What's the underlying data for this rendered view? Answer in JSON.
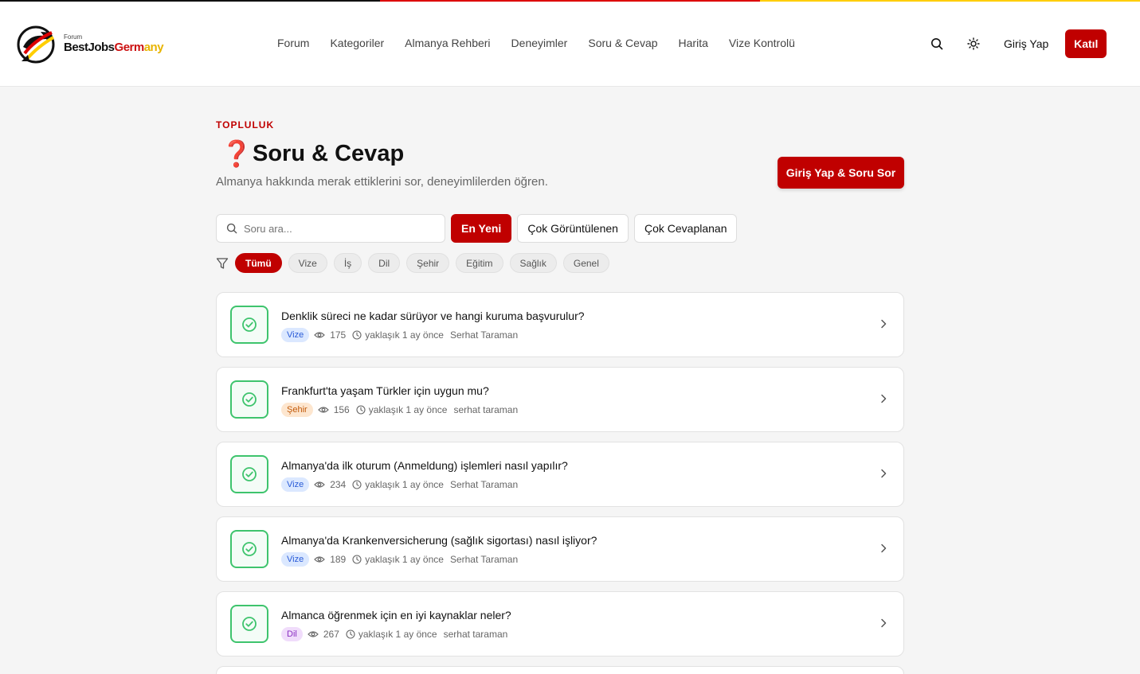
{
  "brand": {
    "small": "Forum",
    "part1": "BestJobs",
    "part2": "Germ",
    "part3": "any"
  },
  "colors": {
    "flag": [
      "#111111",
      "#dd0000",
      "#ffce00"
    ],
    "accent": "#c00000",
    "success": "#3ec46d"
  },
  "nav": [
    "Forum",
    "Kategoriler",
    "Almanya Rehberi",
    "Deneyimler",
    "Soru & Cevap",
    "Harita",
    "Vize Kontrolü"
  ],
  "header": {
    "search_icon": "search-icon",
    "theme_icon": "sun-icon",
    "login": "Giriş Yap",
    "join": "Katıl"
  },
  "page": {
    "kicker": "TOPLULUK",
    "title_icon": "❓",
    "title": "Soru & Cevap",
    "subtitle": "Almanya hakkında merak ettiklerini sor, deneyimlilerden öğren.",
    "ask_button": "Giriş Yap & Soru Sor"
  },
  "search": {
    "placeholder": "Soru ara..."
  },
  "sort": [
    {
      "label": "En Yeni",
      "active": true
    },
    {
      "label": "Çok Görüntülenen",
      "active": false
    },
    {
      "label": "Çok Cevaplanan",
      "active": false
    }
  ],
  "filters": [
    {
      "label": "Tümü",
      "active": true
    },
    {
      "label": "Vize",
      "active": false
    },
    {
      "label": "İş",
      "active": false
    },
    {
      "label": "Dil",
      "active": false
    },
    {
      "label": "Şehir",
      "active": false
    },
    {
      "label": "Eğitim",
      "active": false
    },
    {
      "label": "Sağlık",
      "active": false
    },
    {
      "label": "Genel",
      "active": false
    }
  ],
  "tag_colors": {
    "Vize": {
      "bg": "#dbe8ff",
      "fg": "#2a5bd7"
    },
    "Şehir": {
      "bg": "#fde6cf",
      "fg": "#c25a0a"
    },
    "Dil": {
      "bg": "#f0dcfb",
      "fg": "#8a2fc2"
    }
  },
  "questions": [
    {
      "title": "Denklik süreci ne kadar sürüyor ve hangi kuruma başvurulur?",
      "tag": "Vize",
      "views": "175",
      "time": "yaklaşık 1 ay önce",
      "author": "Serhat Taraman"
    },
    {
      "title": "Frankfurt'ta yaşam Türkler için uygun mu?",
      "tag": "Şehir",
      "views": "156",
      "time": "yaklaşık 1 ay önce",
      "author": "serhat taraman"
    },
    {
      "title": "Almanya'da ilk oturum (Anmeldung) işlemleri nasıl yapılır?",
      "tag": "Vize",
      "views": "234",
      "time": "yaklaşık 1 ay önce",
      "author": "Serhat Taraman"
    },
    {
      "title": "Almanya'da Krankenversicherung (sağlık sigortası) nasıl işliyor?",
      "tag": "Vize",
      "views": "189",
      "time": "yaklaşık 1 ay önce",
      "author": "Serhat Taraman"
    },
    {
      "title": "Almanca öğrenmek için en iyi kaynaklar neler?",
      "tag": "Dil",
      "views": "267",
      "time": "yaklaşık 1 ay önce",
      "author": "serhat taraman"
    }
  ]
}
